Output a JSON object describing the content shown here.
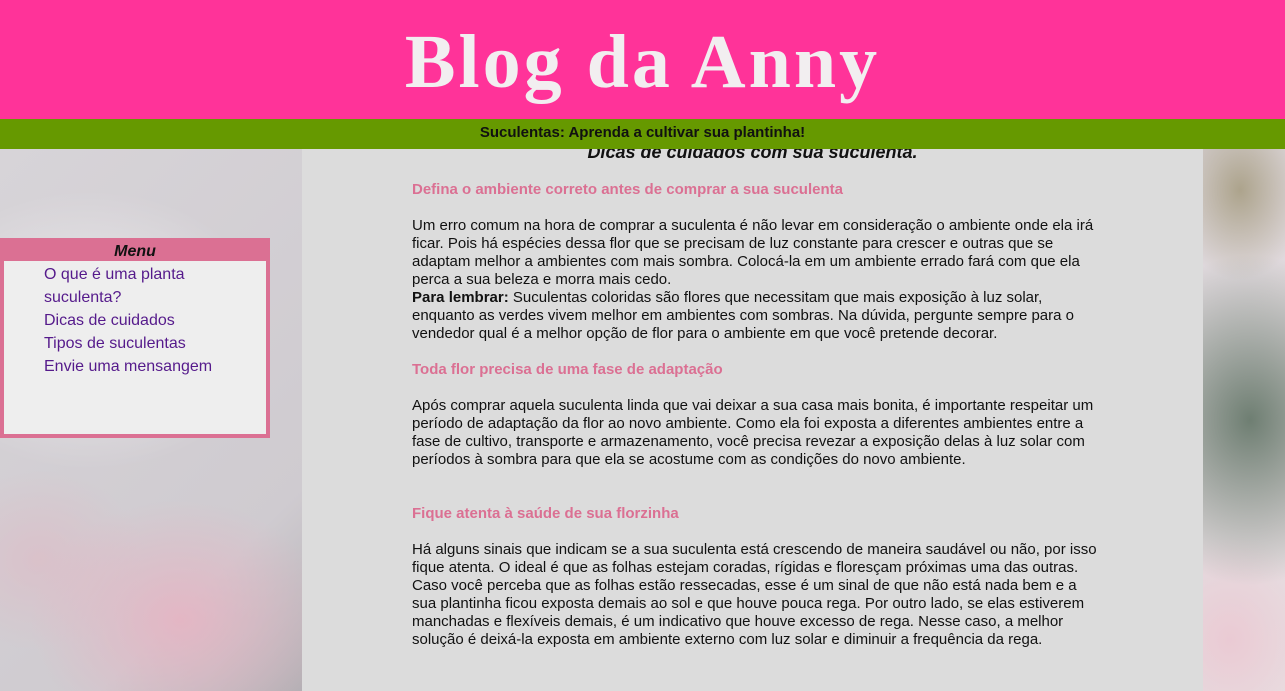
{
  "header": {
    "title": "Blog da Anny",
    "subtitle": "Suculentas: Aprenda a cultivar sua plantinha!"
  },
  "menu": {
    "title": "Menu",
    "items": [
      {
        "label": "O que é uma planta suculenta?"
      },
      {
        "label": "Dicas de cuidados"
      },
      {
        "label": "Tipos de suculentas"
      },
      {
        "label": "Envie uma mensangem"
      }
    ]
  },
  "content": {
    "heading": "Dicas de cuidados com sua suculenta.",
    "sections": [
      {
        "title": "Defina o ambiente correto antes de comprar a sua suculenta",
        "body": "Um erro comum na hora de comprar a suculenta é não levar em consideração o ambiente onde ela irá ficar. Pois há espécies dessa flor que se precisam de luz constante para crescer e outras que se adaptam melhor a ambientes com mais sombra. Colocá-la em um ambiente errado fará com que ela perca a sua beleza e morra mais cedo.",
        "note_label": "Para lembrar:",
        "note": " Suculentas coloridas são flores que necessitam que mais exposição à luz solar, enquanto as verdes vivem melhor em ambientes com sombras. Na dúvida, pergunte sempre para o vendedor qual é a melhor opção de flor para o ambiente em que você pretende decorar."
      },
      {
        "title": "Toda flor precisa de uma fase de adaptação",
        "body": "Após comprar aquela suculenta linda que vai deixar a sua casa mais bonita, é importante respeitar um período de adaptação da flor ao novo ambiente. Como ela foi exposta a diferentes ambientes entre a fase de cultivo, transporte e armazenamento, você precisa revezar a exposição delas à luz solar com períodos à sombra para que ela se acostume com as condições do novo ambiente."
      },
      {
        "title": "Fique atenta à saúde de sua florzinha",
        "body": "Há alguns sinais que indicam se a sua suculenta está crescendo de maneira saudável ou não, por isso fique atenta. O ideal é que as folhas estejam coradas, rígidas e floresçam próximas uma das outras. Caso você perceba que as folhas estão ressecadas, esse é um sinal de que não está nada bem e a sua plantinha ficou exposta demais ao sol e que houve pouca rega. Por outro lado, se elas estiverem manchadas e flexíveis demais, é um indicativo que houve excesso de rega. Nesse caso, a melhor solução é deixá-la exposta em ambiente externo com luz solar e diminuir a frequência da rega."
      }
    ]
  },
  "colors": {
    "header_bg": "#ff3399",
    "subtitle_bg": "#669900",
    "accent_pink": "#db7093",
    "link_purple": "#551a8b",
    "content_bg": "#dcdcdc"
  }
}
